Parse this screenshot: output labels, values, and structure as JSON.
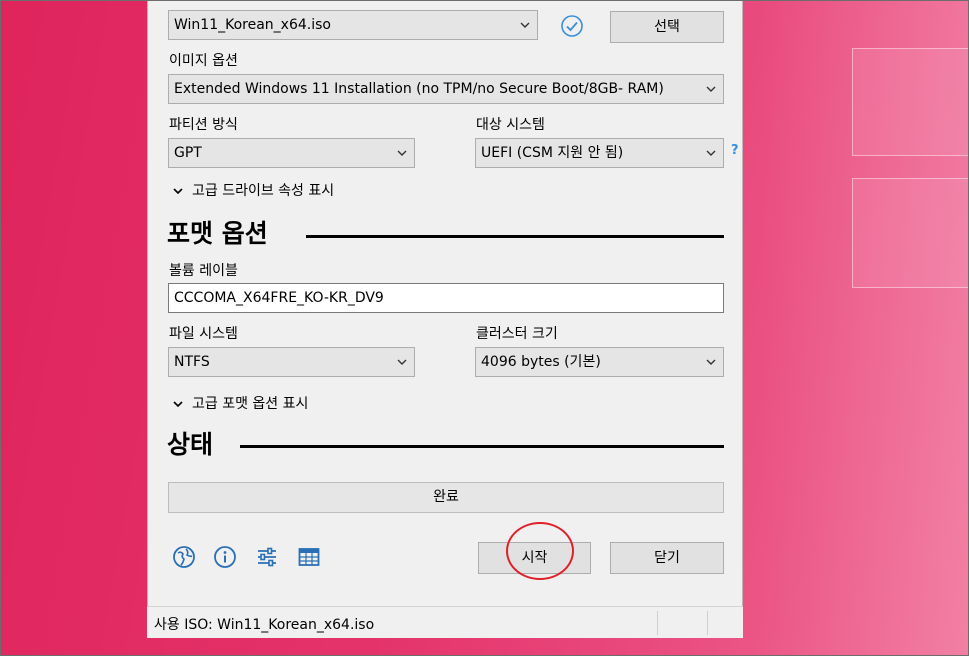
{
  "device": {
    "selected_iso": "Win11_Korean_x64.iso",
    "select_button": "선택",
    "check_icon": "checkmark-circle-icon"
  },
  "image_option": {
    "label": "이미지 옵션",
    "value": "Extended Windows 11 Installation (no TPM/no Secure Boot/8GB- RAM)"
  },
  "partition": {
    "label": "파티션 방식",
    "value": "GPT"
  },
  "target_system": {
    "label": "대상 시스템",
    "value": "UEFI (CSM 지원 안 됨)",
    "help": "?"
  },
  "advanced_drive_toggle": "고급 드라이브 속성 표시",
  "format_section": {
    "title": "포맷 옵션",
    "volume_label_caption": "볼륨 레이블",
    "volume_label_value": "CCCOMA_X64FRE_KO-KR_DV9",
    "filesystem_label": "파일 시스템",
    "filesystem_value": "NTFS",
    "cluster_label": "클러스터 크기",
    "cluster_value": "4096 bytes (기본)",
    "advanced_format_toggle": "고급 포맷 옵션 표시"
  },
  "status_section": {
    "title": "상태",
    "progress_text": "완료",
    "progress": 1.0
  },
  "toolbar_icons": [
    "globe-icon",
    "info-icon",
    "settings-sliders-icon",
    "log-table-icon"
  ],
  "buttons": {
    "start": "시작",
    "close": "닫기"
  },
  "status_bar": {
    "text": "사용 ISO: Win11_Korean_x64.iso"
  },
  "colors": {
    "accent_check": "#3a8fd8",
    "annotation_circle": "#e0202a"
  }
}
